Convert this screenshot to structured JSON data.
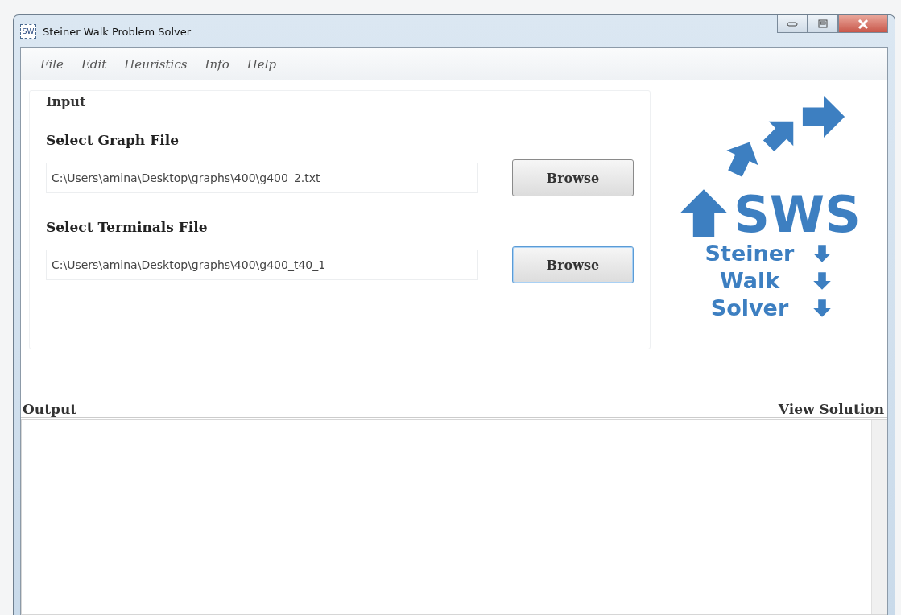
{
  "window": {
    "title": "Steiner Walk Problem Solver",
    "icon_text": "SW"
  },
  "menu": [
    "File",
    "Edit",
    "Heuristics",
    "Info",
    "Help"
  ],
  "input": {
    "title": "Input",
    "fields": [
      {
        "label": "Select Graph File",
        "value": "C:\\Users\\amina\\Desktop\\graphs\\400\\g400_2.txt",
        "button": "Browse",
        "focused": false
      },
      {
        "label": "Select Terminals File",
        "value": "C:\\Users\\amina\\Desktop\\graphs\\400\\g400_t40_1",
        "button": "Browse",
        "focused": true
      }
    ]
  },
  "logo": {
    "acronym": "SWS",
    "words": [
      "Steiner",
      "Walk",
      "Solver"
    ]
  },
  "output": {
    "title": "Output",
    "link": "View Solution"
  }
}
